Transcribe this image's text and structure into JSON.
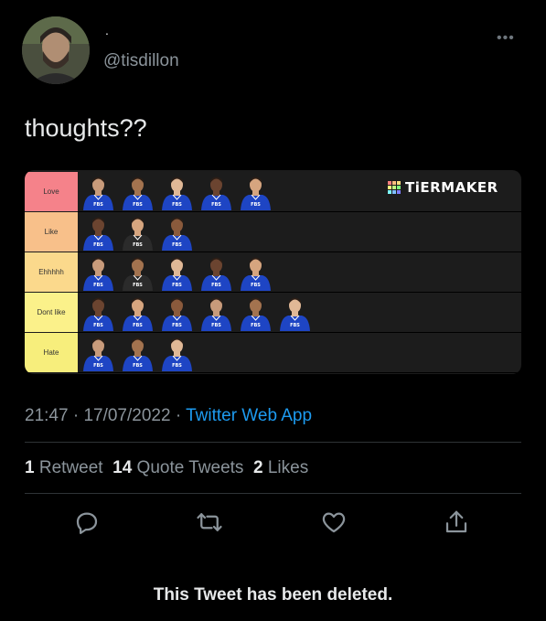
{
  "author": {
    "display_name": ".",
    "handle": "@tisdillon"
  },
  "tweet": {
    "text": "thoughts??",
    "time": "21:47",
    "date": "17/07/2022",
    "source": "Twitter Web App",
    "separator": "·"
  },
  "stats": {
    "retweets_count": "1",
    "retweets_label": "Retweet",
    "quotes_count": "14",
    "quotes_label": "Quote Tweets",
    "likes_count": "2",
    "likes_label": "Likes"
  },
  "tier_list": {
    "logo_text": "TiERMAKER",
    "tiers": [
      {
        "label": "Love",
        "color": "#f5828a",
        "player_count": 5
      },
      {
        "label": "Like",
        "color": "#f8c08a",
        "player_count": 3
      },
      {
        "label": "Ehhhhh",
        "color": "#fbd98c",
        "player_count": 5
      },
      {
        "label": "Dont like",
        "color": "#fbf18a",
        "player_count": 6
      },
      {
        "label": "Hate",
        "color": "#f7ee7c",
        "player_count": 3
      }
    ],
    "jersey_text": "FBS"
  },
  "actions": {
    "reply_icon": "reply-icon",
    "retweet_icon": "retweet-icon",
    "like_icon": "heart-icon",
    "share_icon": "share-icon"
  },
  "notice": "This Tweet has been deleted.",
  "colors": {
    "background": "#000000",
    "text": "#e7e9ea",
    "secondary": "#8b949b",
    "link": "#1d9bf0",
    "jersey": "#1e45c4"
  }
}
